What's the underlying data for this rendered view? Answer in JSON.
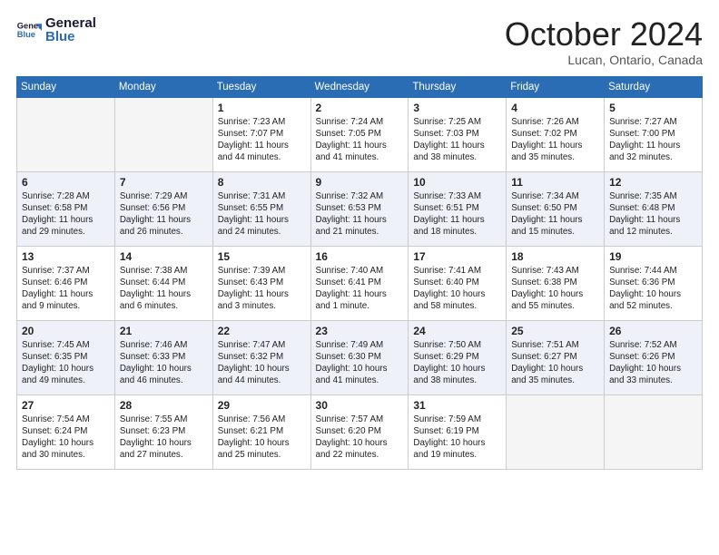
{
  "header": {
    "logo_line1": "General",
    "logo_line2": "Blue",
    "month": "October 2024",
    "location": "Lucan, Ontario, Canada"
  },
  "days_of_week": [
    "Sunday",
    "Monday",
    "Tuesday",
    "Wednesday",
    "Thursday",
    "Friday",
    "Saturday"
  ],
  "weeks": [
    [
      {
        "day": "",
        "sunrise": "",
        "sunset": "",
        "daylight": ""
      },
      {
        "day": "",
        "sunrise": "",
        "sunset": "",
        "daylight": ""
      },
      {
        "day": "1",
        "sunrise": "Sunrise: 7:23 AM",
        "sunset": "Sunset: 7:07 PM",
        "daylight": "Daylight: 11 hours and 44 minutes."
      },
      {
        "day": "2",
        "sunrise": "Sunrise: 7:24 AM",
        "sunset": "Sunset: 7:05 PM",
        "daylight": "Daylight: 11 hours and 41 minutes."
      },
      {
        "day": "3",
        "sunrise": "Sunrise: 7:25 AM",
        "sunset": "Sunset: 7:03 PM",
        "daylight": "Daylight: 11 hours and 38 minutes."
      },
      {
        "day": "4",
        "sunrise": "Sunrise: 7:26 AM",
        "sunset": "Sunset: 7:02 PM",
        "daylight": "Daylight: 11 hours and 35 minutes."
      },
      {
        "day": "5",
        "sunrise": "Sunrise: 7:27 AM",
        "sunset": "Sunset: 7:00 PM",
        "daylight": "Daylight: 11 hours and 32 minutes."
      }
    ],
    [
      {
        "day": "6",
        "sunrise": "Sunrise: 7:28 AM",
        "sunset": "Sunset: 6:58 PM",
        "daylight": "Daylight: 11 hours and 29 minutes."
      },
      {
        "day": "7",
        "sunrise": "Sunrise: 7:29 AM",
        "sunset": "Sunset: 6:56 PM",
        "daylight": "Daylight: 11 hours and 26 minutes."
      },
      {
        "day": "8",
        "sunrise": "Sunrise: 7:31 AM",
        "sunset": "Sunset: 6:55 PM",
        "daylight": "Daylight: 11 hours and 24 minutes."
      },
      {
        "day": "9",
        "sunrise": "Sunrise: 7:32 AM",
        "sunset": "Sunset: 6:53 PM",
        "daylight": "Daylight: 11 hours and 21 minutes."
      },
      {
        "day": "10",
        "sunrise": "Sunrise: 7:33 AM",
        "sunset": "Sunset: 6:51 PM",
        "daylight": "Daylight: 11 hours and 18 minutes."
      },
      {
        "day": "11",
        "sunrise": "Sunrise: 7:34 AM",
        "sunset": "Sunset: 6:50 PM",
        "daylight": "Daylight: 11 hours and 15 minutes."
      },
      {
        "day": "12",
        "sunrise": "Sunrise: 7:35 AM",
        "sunset": "Sunset: 6:48 PM",
        "daylight": "Daylight: 11 hours and 12 minutes."
      }
    ],
    [
      {
        "day": "13",
        "sunrise": "Sunrise: 7:37 AM",
        "sunset": "Sunset: 6:46 PM",
        "daylight": "Daylight: 11 hours and 9 minutes."
      },
      {
        "day": "14",
        "sunrise": "Sunrise: 7:38 AM",
        "sunset": "Sunset: 6:44 PM",
        "daylight": "Daylight: 11 hours and 6 minutes."
      },
      {
        "day": "15",
        "sunrise": "Sunrise: 7:39 AM",
        "sunset": "Sunset: 6:43 PM",
        "daylight": "Daylight: 11 hours and 3 minutes."
      },
      {
        "day": "16",
        "sunrise": "Sunrise: 7:40 AM",
        "sunset": "Sunset: 6:41 PM",
        "daylight": "Daylight: 11 hours and 1 minute."
      },
      {
        "day": "17",
        "sunrise": "Sunrise: 7:41 AM",
        "sunset": "Sunset: 6:40 PM",
        "daylight": "Daylight: 10 hours and 58 minutes."
      },
      {
        "day": "18",
        "sunrise": "Sunrise: 7:43 AM",
        "sunset": "Sunset: 6:38 PM",
        "daylight": "Daylight: 10 hours and 55 minutes."
      },
      {
        "day": "19",
        "sunrise": "Sunrise: 7:44 AM",
        "sunset": "Sunset: 6:36 PM",
        "daylight": "Daylight: 10 hours and 52 minutes."
      }
    ],
    [
      {
        "day": "20",
        "sunrise": "Sunrise: 7:45 AM",
        "sunset": "Sunset: 6:35 PM",
        "daylight": "Daylight: 10 hours and 49 minutes."
      },
      {
        "day": "21",
        "sunrise": "Sunrise: 7:46 AM",
        "sunset": "Sunset: 6:33 PM",
        "daylight": "Daylight: 10 hours and 46 minutes."
      },
      {
        "day": "22",
        "sunrise": "Sunrise: 7:47 AM",
        "sunset": "Sunset: 6:32 PM",
        "daylight": "Daylight: 10 hours and 44 minutes."
      },
      {
        "day": "23",
        "sunrise": "Sunrise: 7:49 AM",
        "sunset": "Sunset: 6:30 PM",
        "daylight": "Daylight: 10 hours and 41 minutes."
      },
      {
        "day": "24",
        "sunrise": "Sunrise: 7:50 AM",
        "sunset": "Sunset: 6:29 PM",
        "daylight": "Daylight: 10 hours and 38 minutes."
      },
      {
        "day": "25",
        "sunrise": "Sunrise: 7:51 AM",
        "sunset": "Sunset: 6:27 PM",
        "daylight": "Daylight: 10 hours and 35 minutes."
      },
      {
        "day": "26",
        "sunrise": "Sunrise: 7:52 AM",
        "sunset": "Sunset: 6:26 PM",
        "daylight": "Daylight: 10 hours and 33 minutes."
      }
    ],
    [
      {
        "day": "27",
        "sunrise": "Sunrise: 7:54 AM",
        "sunset": "Sunset: 6:24 PM",
        "daylight": "Daylight: 10 hours and 30 minutes."
      },
      {
        "day": "28",
        "sunrise": "Sunrise: 7:55 AM",
        "sunset": "Sunset: 6:23 PM",
        "daylight": "Daylight: 10 hours and 27 minutes."
      },
      {
        "day": "29",
        "sunrise": "Sunrise: 7:56 AM",
        "sunset": "Sunset: 6:21 PM",
        "daylight": "Daylight: 10 hours and 25 minutes."
      },
      {
        "day": "30",
        "sunrise": "Sunrise: 7:57 AM",
        "sunset": "Sunset: 6:20 PM",
        "daylight": "Daylight: 10 hours and 22 minutes."
      },
      {
        "day": "31",
        "sunrise": "Sunrise: 7:59 AM",
        "sunset": "Sunset: 6:19 PM",
        "daylight": "Daylight: 10 hours and 19 minutes."
      },
      {
        "day": "",
        "sunrise": "",
        "sunset": "",
        "daylight": ""
      },
      {
        "day": "",
        "sunrise": "",
        "sunset": "",
        "daylight": ""
      }
    ]
  ]
}
